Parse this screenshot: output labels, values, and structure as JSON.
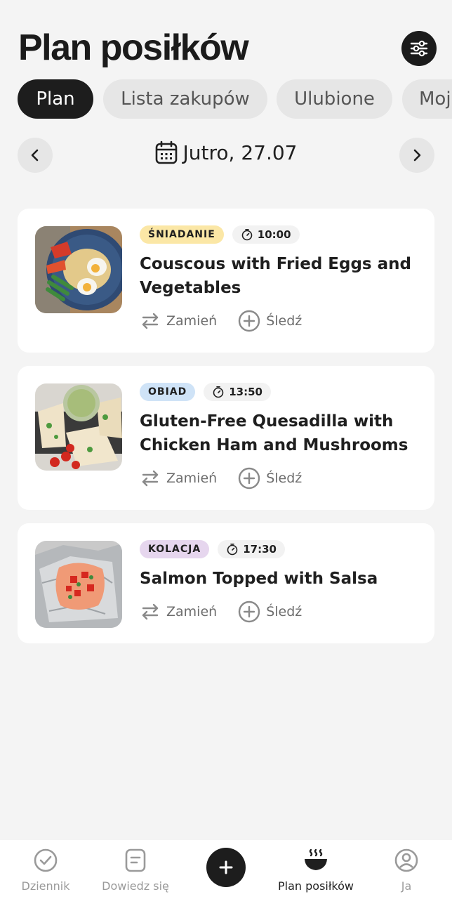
{
  "header": {
    "title": "Plan posiłków",
    "filter_icon": "sliders-icon"
  },
  "tabs": [
    {
      "label": "Plan",
      "active": true
    },
    {
      "label": "Lista zakupów",
      "active": false
    },
    {
      "label": "Ulubione",
      "active": false
    },
    {
      "label": "Moj",
      "active": false
    }
  ],
  "date_nav": {
    "label": "Jutro, 27.07",
    "prev_icon": "chevron-left-icon",
    "next_icon": "chevron-right-icon",
    "calendar_icon": "calendar-icon"
  },
  "meals": [
    {
      "type": "ŚNIADANIE",
      "type_color": "#fbe7a6",
      "time": "10:00",
      "title": "Couscous with Fried Eggs and Vegetables",
      "swap_label": "Zamień",
      "track_label": "Śledź"
    },
    {
      "type": "OBIAD",
      "type_color": "#cfe3f7",
      "time": "13:50",
      "title": "Gluten-Free Quesadilla with Chicken Ham and Mushrooms",
      "swap_label": "Zamień",
      "track_label": "Śledź"
    },
    {
      "type": "KOLACJA",
      "type_color": "#e6d6ee",
      "time": "17:30",
      "title": "Salmon Topped with Salsa",
      "swap_label": "Zamień",
      "track_label": "Śledź"
    }
  ],
  "bottom_nav": [
    {
      "label": "Dziennik",
      "icon": "check-circle-icon",
      "active": false
    },
    {
      "label": "Dowiedz się",
      "icon": "document-icon",
      "active": false
    },
    {
      "label": "",
      "icon": "plus-icon",
      "active": false
    },
    {
      "label": "Plan posiłków",
      "icon": "bowl-icon",
      "active": true
    },
    {
      "label": "Ja",
      "icon": "user-circle-icon",
      "active": false
    }
  ]
}
